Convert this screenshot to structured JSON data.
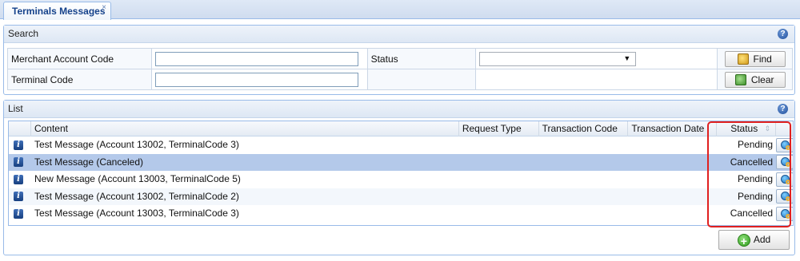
{
  "tabs": [
    {
      "label": "Terminals Messages",
      "close": "×"
    }
  ],
  "search": {
    "title": "Search",
    "help": "?",
    "merchant_label": "Merchant Account Code",
    "merchant_value": "",
    "status_label": "Status",
    "status_value": "",
    "status_arrow": "▼",
    "terminal_label": "Terminal Code",
    "terminal_value": "",
    "find_label": "Find",
    "clear_label": "Clear"
  },
  "list": {
    "title": "List",
    "help": "?",
    "columns": {
      "content": "Content",
      "request_type": "Request Type",
      "transaction_code": "Transaction Code",
      "transaction_date": "Transaction Date",
      "status": "Status",
      "status_sort": "⇕"
    },
    "rows": [
      {
        "icon": "i",
        "content": "Test Message (Account 13002, TerminalCode 3)",
        "request_type": "",
        "transaction_code": "",
        "transaction_date": "",
        "status": "Pending"
      },
      {
        "icon": "i",
        "content": "Test Message (Canceled)",
        "request_type": "",
        "transaction_code": "",
        "transaction_date": "",
        "status": "Cancelled"
      },
      {
        "icon": "i",
        "content": "New Message (Account 13003, TerminalCode 5)",
        "request_type": "",
        "transaction_code": "",
        "transaction_date": "",
        "status": "Pending"
      },
      {
        "icon": "i",
        "content": "Test Message (Account 13002, TerminalCode 2)",
        "request_type": "",
        "transaction_code": "",
        "transaction_date": "",
        "status": "Pending"
      },
      {
        "icon": "i",
        "content": "Test Message (Account 13003, TerminalCode 3)",
        "request_type": "",
        "transaction_code": "",
        "transaction_date": "",
        "status": "Cancelled"
      }
    ],
    "selected_row": 1,
    "add_label": "Add",
    "add_plus": "+"
  },
  "icons": {
    "row_info": "info-icon",
    "row_view": "view-details-icon",
    "help": "help-icon",
    "find": "find-icon",
    "clear": "clear-icon",
    "add": "add-icon"
  },
  "colors": {
    "tab_text": "#15428b",
    "panel_border": "#99bbe8",
    "selected_row": "#b4c9ea",
    "highlight": "#e02020"
  }
}
